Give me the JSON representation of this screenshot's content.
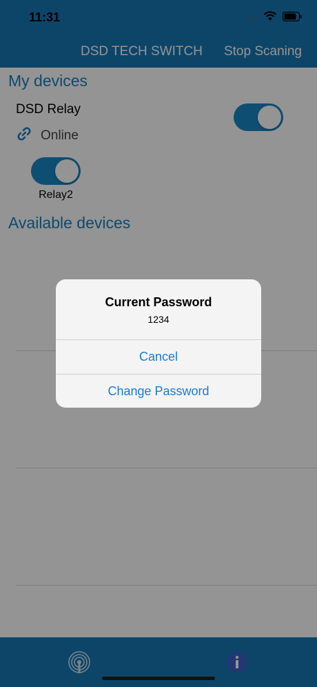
{
  "status_bar": {
    "time": "11:31",
    "icons": [
      "wifi-icon",
      "battery-icon"
    ]
  },
  "nav": {
    "title": "DSD TECH SWITCH",
    "action": "Stop Scaning"
  },
  "my_devices": {
    "title": "My devices",
    "device": {
      "name": "DSD Relay",
      "status": "Online",
      "status_icon": "link-icon"
    },
    "relay": {
      "label": "Relay2"
    }
  },
  "available_devices": {
    "title": "Available devices"
  },
  "tab_bar": {
    "items": [
      "scan-icon",
      "info-icon"
    ]
  },
  "alert": {
    "title": "Current Password",
    "message": "1234",
    "buttons": {
      "cancel": "Cancel",
      "change": "Change Password"
    }
  },
  "colors": {
    "brand": "#1877b3",
    "accent": "#1a87c6",
    "alert_button": "#1a7ad9"
  }
}
